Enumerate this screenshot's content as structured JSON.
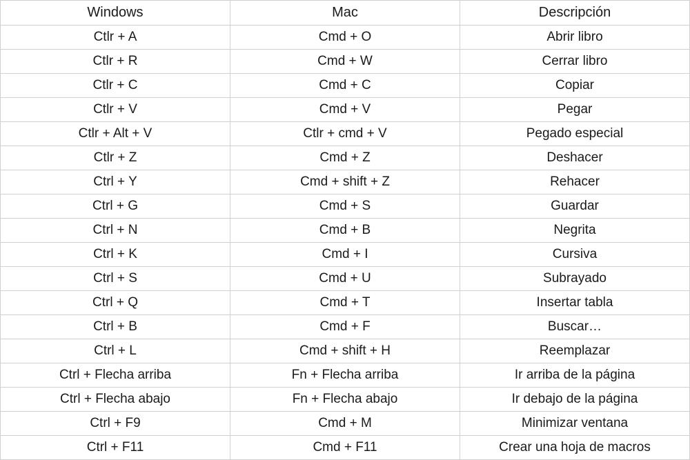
{
  "headers": {
    "windows": "Windows",
    "mac": "Mac",
    "description": "Descripción"
  },
  "rows": [
    {
      "windows": "Ctlr + A",
      "mac": "Cmd + O",
      "description": "Abrir libro"
    },
    {
      "windows": "Ctlr + R",
      "mac": "Cmd + W",
      "description": "Cerrar libro"
    },
    {
      "windows": "Ctlr + C",
      "mac": "Cmd + C",
      "description": "Copiar"
    },
    {
      "windows": "Ctlr + V",
      "mac": "Cmd + V",
      "description": "Pegar"
    },
    {
      "windows": "Ctlr + Alt + V",
      "mac": "Ctlr + cmd + V",
      "description": "Pegado especial"
    },
    {
      "windows": "Ctlr + Z",
      "mac": "Cmd + Z",
      "description": "Deshacer"
    },
    {
      "windows": "Ctrl + Y",
      "mac": "Cmd + shift + Z",
      "description": "Rehacer"
    },
    {
      "windows": "Ctrl + G",
      "mac": "Cmd + S",
      "description": "Guardar"
    },
    {
      "windows": "Ctrl + N",
      "mac": "Cmd + B",
      "description": "Negrita"
    },
    {
      "windows": "Ctrl + K",
      "mac": "Cmd + I",
      "description": "Cursiva"
    },
    {
      "windows": "Ctrl + S",
      "mac": "Cmd + U",
      "description": "Subrayado"
    },
    {
      "windows": "Ctrl + Q",
      "mac": "Cmd + T",
      "description": "Insertar tabla"
    },
    {
      "windows": "Ctrl + B",
      "mac": "Cmd + F",
      "description": "Buscar…"
    },
    {
      "windows": "Ctrl + L",
      "mac": "Cmd + shift + H",
      "description": "Reemplazar"
    },
    {
      "windows": "Ctrl + Flecha arriba",
      "mac": "Fn + Flecha arriba",
      "description": "Ir arriba de la página"
    },
    {
      "windows": "Ctrl + Flecha abajo",
      "mac": "Fn + Flecha abajo",
      "description": "Ir debajo de la página"
    },
    {
      "windows": "Ctrl + F9",
      "mac": "Cmd + M",
      "description": "Minimizar ventana"
    },
    {
      "windows": "Ctrl + F11",
      "mac": "Cmd + F11",
      "description": "Crear una hoja de macros"
    }
  ]
}
